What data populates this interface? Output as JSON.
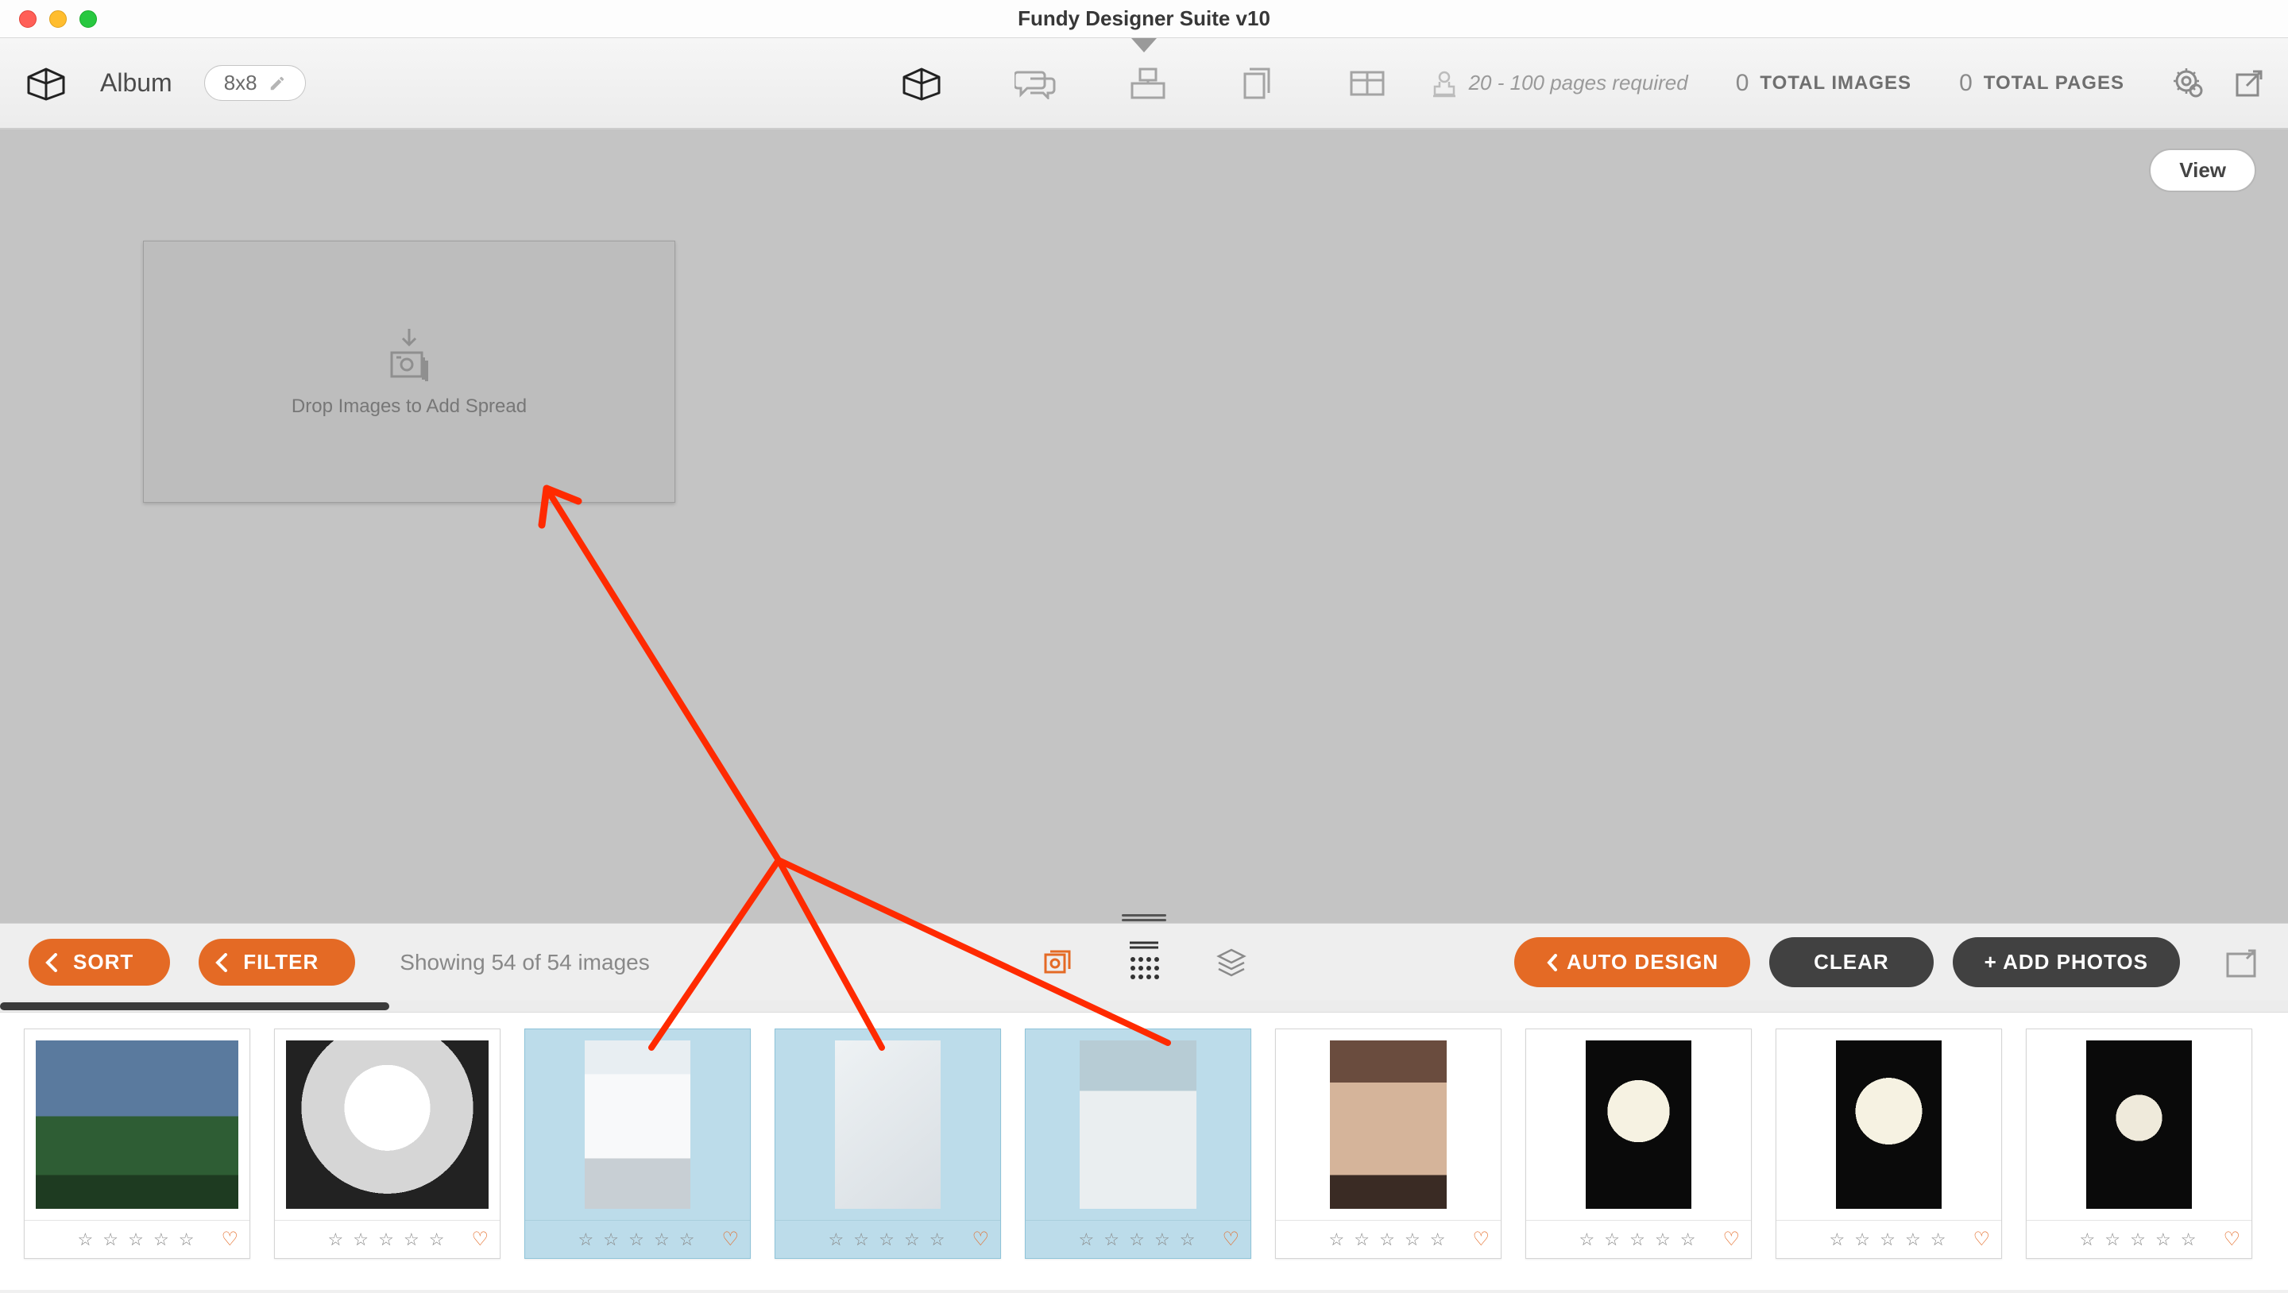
{
  "window": {
    "title": "Fundy Designer Suite v10"
  },
  "toolbar": {
    "module_label": "Album",
    "size_label": "8x8",
    "page_requirement": "20 - 100 pages required",
    "total_images": {
      "count": "0",
      "label": "TOTAL IMAGES"
    },
    "total_pages": {
      "count": "0",
      "label": "TOTAL PAGES"
    }
  },
  "canvas": {
    "view_button": "View",
    "dropzone_text": "Drop Images to Add Spread"
  },
  "controls": {
    "sort_label": "SORT",
    "filter_label": "FILTER",
    "showing_text": "Showing 54 of 54 images",
    "auto_design_label": "AUTO DESIGN",
    "clear_label": "CLEAR",
    "add_photos_label": "+ ADD PHOTOS"
  },
  "thumbnails": [
    {
      "selected": false
    },
    {
      "selected": false
    },
    {
      "selected": true
    },
    {
      "selected": true
    },
    {
      "selected": true
    },
    {
      "selected": false
    },
    {
      "selected": false
    },
    {
      "selected": false
    },
    {
      "selected": false
    }
  ]
}
